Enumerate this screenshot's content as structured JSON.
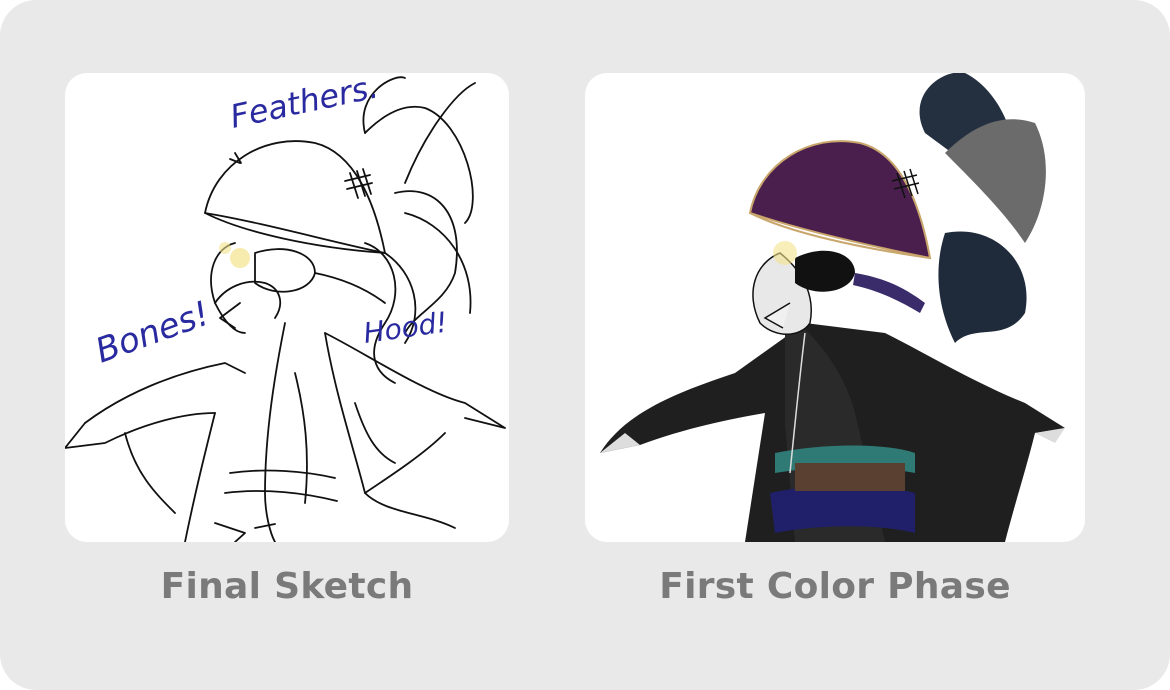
{
  "panels": [
    {
      "caption": "Final Sketch",
      "annotations": [
        "Feathers.",
        "Bones!",
        "Hood!"
      ]
    },
    {
      "caption": "First Color Phase"
    }
  ],
  "colors": {
    "background": "#e9e9e9",
    "caption": "#7a7a7a",
    "annotation_ink": "#2a2aa0",
    "hat_purple": "#4a1f4e",
    "robe_black": "#1e1e1e",
    "sash_teal": "#2f7a74",
    "belt_navy": "#20206a"
  }
}
